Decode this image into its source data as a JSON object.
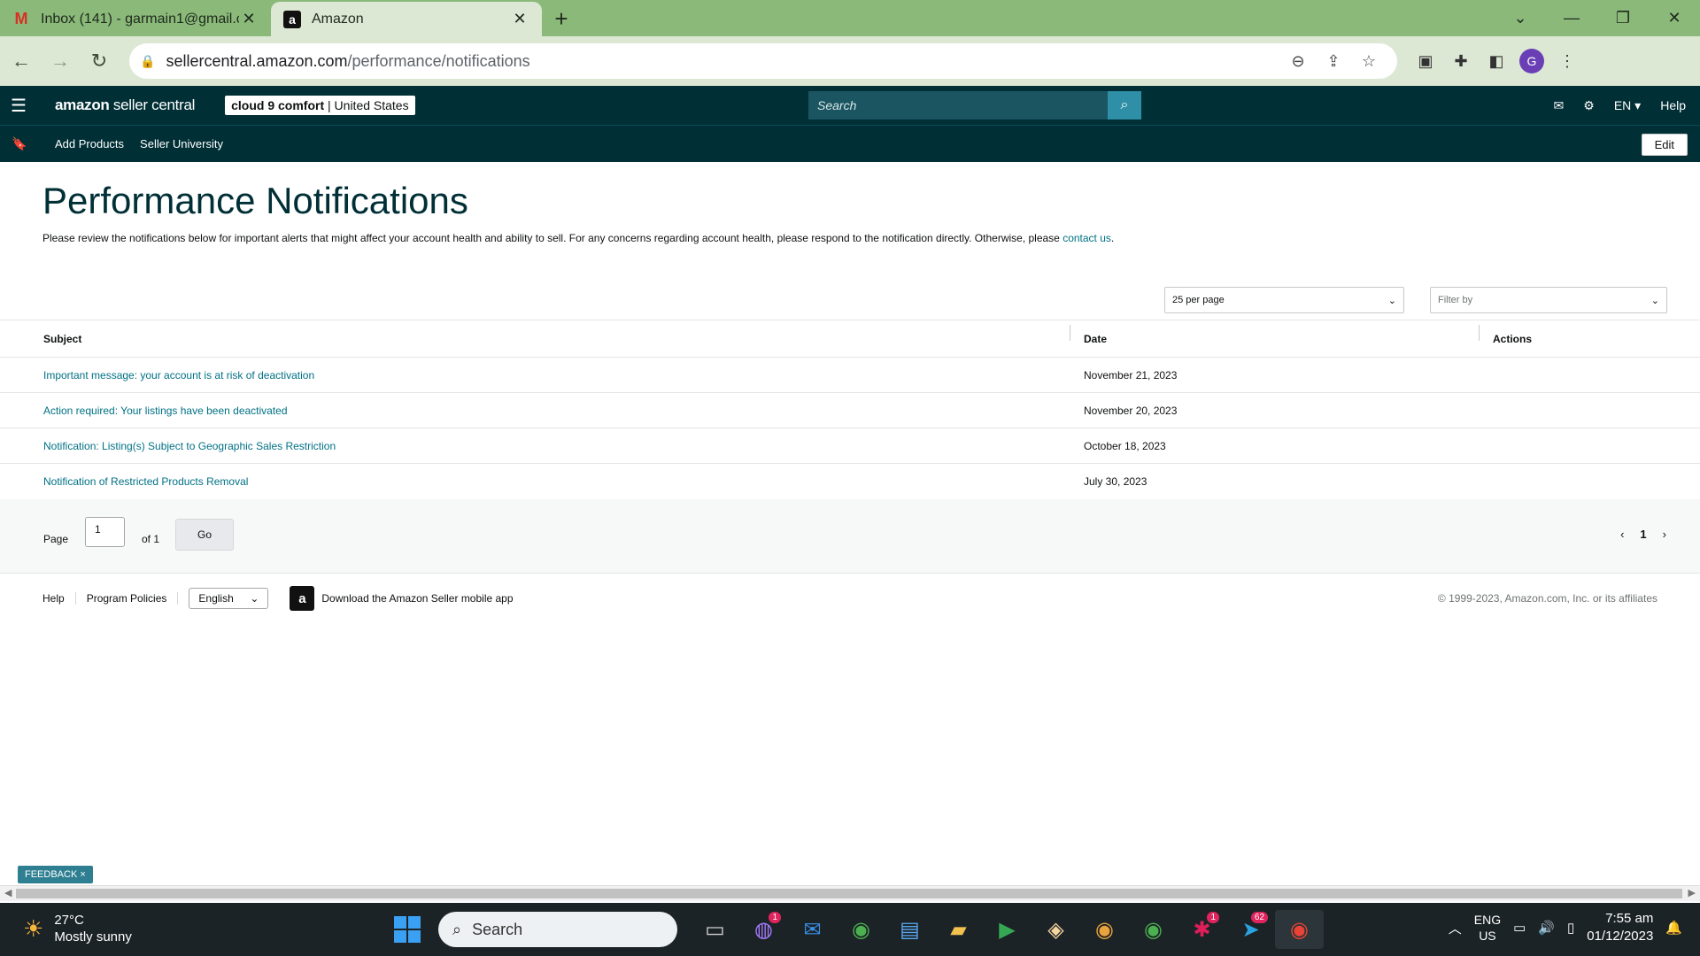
{
  "browser": {
    "tabs": [
      {
        "title": "Inbox (141) - garmain1@gmail.c",
        "icon": "gmail-icon"
      },
      {
        "title": "Amazon",
        "icon": "amazon-icon"
      }
    ],
    "url_host": "sellercentral.amazon.com",
    "url_path": "/performance/notifications",
    "avatar_letter": "G"
  },
  "header": {
    "brand_bold": "amazon",
    "brand_light": " seller central",
    "store_name": "cloud 9 comfort",
    "store_region": "United States",
    "search_placeholder": "Search",
    "language": "EN",
    "help": "Help"
  },
  "subnav": {
    "links": [
      "Add Products",
      "Seller University"
    ],
    "edit_label": "Edit"
  },
  "page": {
    "title": "Performance Notifications",
    "description": "Please review the notifications below for important alerts that might affect your account health and ability to sell. For any concerns regarding account health, please respond to the notification directly. Otherwise, please ",
    "contact_link": "contact us",
    "per_page": "25 per page",
    "filter_placeholder": "Filter by"
  },
  "table": {
    "headers": [
      "Subject",
      "Date",
      "Actions"
    ],
    "rows": [
      {
        "subject": "Important message: your account is at risk of deactivation",
        "date": "November 21, 2023"
      },
      {
        "subject": "Action required: Your listings have been deactivated",
        "date": "November 20, 2023"
      },
      {
        "subject": "Notification: Listing(s) Subject to Geographic Sales Restriction",
        "date": "October 18, 2023"
      },
      {
        "subject": "Notification of Restricted Products Removal",
        "date": "July 30, 2023"
      }
    ]
  },
  "pager": {
    "page_label": "Page",
    "page_value": "1",
    "of_label": "of 1",
    "go_label": "Go",
    "current_page": "1"
  },
  "footer": {
    "help": "Help",
    "policies": "Program Policies",
    "language": "English",
    "app_text": "Download the Amazon Seller mobile app",
    "copyright": "© 1999-2023, Amazon.com, Inc. or its affiliates"
  },
  "feedback_label": "FEEDBACK ×",
  "taskbar": {
    "temperature": "27°C",
    "weather": "Mostly sunny",
    "search": "Search",
    "lang_top": "ENG",
    "lang_bottom": "US",
    "time": "7:55 am",
    "date": "01/12/2023",
    "badges": [
      "1",
      "1",
      "62"
    ]
  },
  "colors": {
    "header_bg": "#002f36",
    "link": "#007185",
    "tab_bg": "#8ab97a"
  }
}
